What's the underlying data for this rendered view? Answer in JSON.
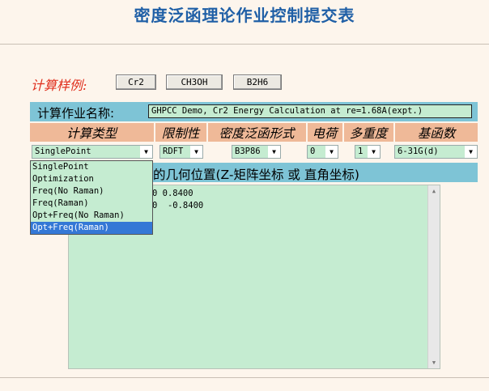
{
  "title": "密度泛函理论作业控制提交表",
  "examples": {
    "label": "计算样例:",
    "buttons": [
      "Cr2",
      "CH3OH",
      "B2H6"
    ]
  },
  "job": {
    "label": "计算作业名称:",
    "value": "GHPCC Demo, Cr2 Energy Calculation at re=1.68A(expt.)"
  },
  "headers": {
    "calc_type": "计算类型",
    "restriction": "限制性",
    "functional": "密度泛函形式",
    "charge": "电荷",
    "multiplicity": "多重度",
    "basis": "基函数"
  },
  "selects": {
    "calc_type": "SinglePoint",
    "restriction": "RDFT",
    "functional": "B3P86",
    "charge": "0",
    "multiplicity": "1",
    "basis": "6-31G(d)"
  },
  "dropdown": {
    "options": [
      "SinglePoint",
      "Optimization",
      "Freq(No Raman)",
      "Freq(Raman)",
      "Opt+Freq(No Raman)",
      "Opt+Freq(Raman)"
    ],
    "highlighted": "Opt+Freq(Raman)"
  },
  "geometry": {
    "label": "的几何位置(Z-矩阵坐标 或 直角坐标)",
    "lines": [
      "0 0.8400",
      "0  -0.8400"
    ]
  },
  "colors": {
    "title": "#1f5fa6",
    "examples_label": "#e0301e",
    "blue_band": "#7ec4d6",
    "header_band": "#efb998",
    "field_bg": "#c5ecd1",
    "highlight": "#3478d6"
  },
  "icons": {
    "select_arrow": "chevron-down-icon",
    "scroll_up": "arrow-up-icon",
    "scroll_down": "arrow-down-icon"
  }
}
